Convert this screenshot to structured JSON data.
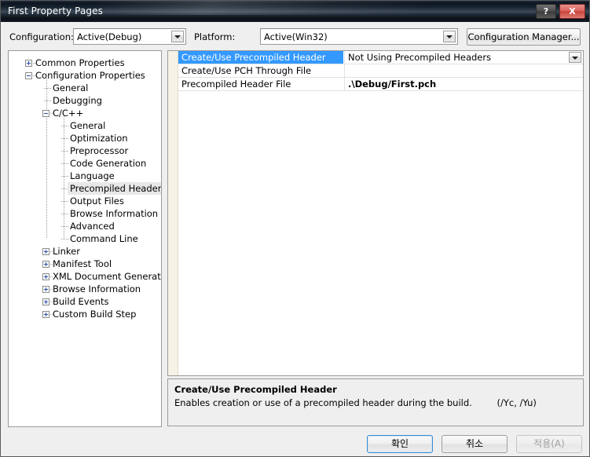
{
  "window": {
    "title": "First Property Pages",
    "help_button": "?",
    "close_button": "X"
  },
  "config_bar": {
    "configuration_label": "Configuration:",
    "configuration_value": "Active(Debug)",
    "platform_label": "Platform:",
    "platform_value": "Active(Win32)",
    "configuration_manager_button": "Configuration Manager..."
  },
  "tree": {
    "nodes": [
      {
        "label": "Common Properties",
        "depth": 0,
        "expander": "plus",
        "selected": false
      },
      {
        "label": "Configuration Properties",
        "depth": 0,
        "expander": "minus",
        "selected": false
      },
      {
        "label": "General",
        "depth": 1,
        "expander": "none",
        "selected": false
      },
      {
        "label": "Debugging",
        "depth": 1,
        "expander": "none",
        "selected": false
      },
      {
        "label": "C/C++",
        "depth": 1,
        "expander": "minus",
        "selected": false
      },
      {
        "label": "General",
        "depth": 2,
        "expander": "none",
        "selected": false
      },
      {
        "label": "Optimization",
        "depth": 2,
        "expander": "none",
        "selected": false
      },
      {
        "label": "Preprocessor",
        "depth": 2,
        "expander": "none",
        "selected": false
      },
      {
        "label": "Code Generation",
        "depth": 2,
        "expander": "none",
        "selected": false
      },
      {
        "label": "Language",
        "depth": 2,
        "expander": "none",
        "selected": false
      },
      {
        "label": "Precompiled Headers",
        "depth": 2,
        "expander": "none",
        "selected": true
      },
      {
        "label": "Output Files",
        "depth": 2,
        "expander": "none",
        "selected": false
      },
      {
        "label": "Browse Information",
        "depth": 2,
        "expander": "none",
        "selected": false
      },
      {
        "label": "Advanced",
        "depth": 2,
        "expander": "none",
        "selected": false
      },
      {
        "label": "Command Line",
        "depth": 2,
        "expander": "none",
        "selected": false
      },
      {
        "label": "Linker",
        "depth": 1,
        "expander": "plus",
        "selected": false
      },
      {
        "label": "Manifest Tool",
        "depth": 1,
        "expander": "plus",
        "selected": false
      },
      {
        "label": "XML Document Generator",
        "depth": 1,
        "expander": "plus",
        "selected": false
      },
      {
        "label": "Browse Information",
        "depth": 1,
        "expander": "plus",
        "selected": false
      },
      {
        "label": "Build Events",
        "depth": 1,
        "expander": "plus",
        "selected": false
      },
      {
        "label": "Custom Build Step",
        "depth": 1,
        "expander": "plus",
        "selected": false
      }
    ]
  },
  "property_grid": {
    "rows": [
      {
        "name": "Create/Use Precompiled Header",
        "value": "Not Using Precompiled Headers",
        "selected": true,
        "has_dropdown": true,
        "bold": false
      },
      {
        "name": "Create/Use PCH Through File",
        "value": "",
        "selected": false,
        "has_dropdown": false,
        "bold": false
      },
      {
        "name": "Precompiled Header File",
        "value": ".\\Debug/First.pch",
        "selected": false,
        "has_dropdown": false,
        "bold": true
      }
    ]
  },
  "description": {
    "title": "Create/Use Precompiled Header",
    "body": "Enables creation or use of a precompiled header during the build.",
    "switches": "(/Yc, /Yu)"
  },
  "buttons": {
    "ok": "확인",
    "cancel": "취소",
    "apply": "적용(A)"
  },
  "colors": {
    "selection_blue": "#3399ff",
    "titlebar_dark": "#0d1520",
    "close_red": "#c8443c",
    "gutter_beige": "#f5f2e6"
  }
}
